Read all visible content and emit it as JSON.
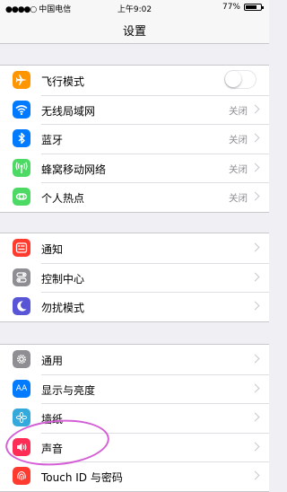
{
  "status_bar": {
    "carrier": "中国电信",
    "time": "上午9:02",
    "battery_percent": "77%",
    "battery_level": 0.77
  },
  "nav": {
    "title": "设置"
  },
  "groups": [
    {
      "rows": [
        {
          "label": "飞行模式",
          "icon": "airplane-icon",
          "color": "#ff9500",
          "control": "toggle",
          "toggle_on": false
        },
        {
          "label": "无线局域网",
          "icon": "wifi-icon",
          "color": "#007aff",
          "value": "关闭"
        },
        {
          "label": "蓝牙",
          "icon": "bluetooth-icon",
          "color": "#007aff",
          "value": "关闭"
        },
        {
          "label": "蜂窝移动网络",
          "icon": "cellular-icon",
          "color": "#4cd964",
          "value": "关闭"
        },
        {
          "label": "个人热点",
          "icon": "hotspot-icon",
          "color": "#4cd964",
          "value": "关闭"
        }
      ]
    },
    {
      "rows": [
        {
          "label": "通知",
          "icon": "notifications-icon",
          "color": "#ff3b30"
        },
        {
          "label": "控制中心",
          "icon": "control-center-icon",
          "color": "#8e8e93"
        },
        {
          "label": "勿扰模式",
          "icon": "moon-icon",
          "color": "#5856d6"
        }
      ]
    },
    {
      "rows": [
        {
          "label": "通用",
          "icon": "gear-icon",
          "color": "#8e8e93"
        },
        {
          "label": "显示与亮度",
          "icon": "display-brightness-icon",
          "color": "#007aff",
          "icon_text": "AA"
        },
        {
          "label": "墙纸",
          "icon": "wallpaper-icon",
          "color": "#34aadc"
        },
        {
          "label": "声音",
          "icon": "sound-icon",
          "color": "#ff2d55"
        },
        {
          "label": "Touch ID 与密码",
          "icon": "fingerprint-icon",
          "color": "#ff3b30"
        }
      ]
    }
  ],
  "annotation_color": "#d45fd6"
}
